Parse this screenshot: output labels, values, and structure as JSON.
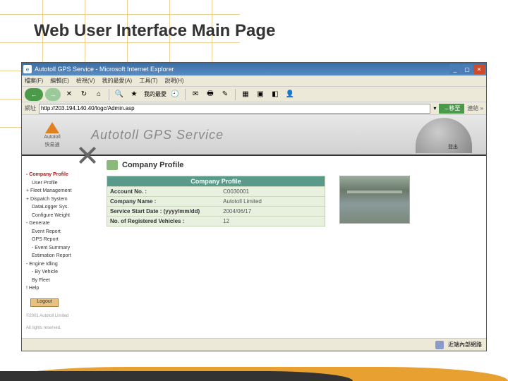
{
  "slide": {
    "title": "Web User Interface Main Page"
  },
  "browser": {
    "title": "Autotoll GPS Service - Microsoft Internet Explorer",
    "menus": [
      "檔案(F)",
      "編輯(E)",
      "檢視(V)",
      "我的最愛(A)",
      "工具(T)",
      "說明(H)"
    ],
    "favorites_label": "我的最愛",
    "address_label": "網址",
    "address_value": "http://203.194.140.40/logc/Admin.asp",
    "go_label": "移至",
    "links_label": "連結 »",
    "status_text": "近端內部網路"
  },
  "app": {
    "logo_text": "Autotoll",
    "logo_sub": "快易通",
    "banner_title": "Autotoll GPS Service",
    "logout_link": "登出"
  },
  "sidebar": {
    "items": [
      {
        "label": "- Company Profile",
        "red": true,
        "indent": false
      },
      {
        "label": "User Profile",
        "red": false,
        "indent": true
      },
      {
        "label": "+ Fleet Management",
        "red": false,
        "indent": false
      },
      {
        "label": "+ Dispatch System",
        "red": false,
        "indent": false
      },
      {
        "label": "DataLogger Sys.",
        "red": false,
        "indent": true
      },
      {
        "label": "Configure Weight",
        "red": false,
        "indent": true
      },
      {
        "label": "- Generate",
        "red": false,
        "indent": false
      },
      {
        "label": "Event Report",
        "red": false,
        "indent": true
      },
      {
        "label": "GPS Report",
        "red": false,
        "indent": true
      },
      {
        "label": "- Event Summary",
        "red": false,
        "indent": true
      },
      {
        "label": "Estimation Report",
        "red": false,
        "indent": true
      },
      {
        "label": "- Engine Idling",
        "red": false,
        "indent": false
      },
      {
        "label": "- By Vehicle",
        "red": false,
        "indent": true
      },
      {
        "label": "By Fleet",
        "red": false,
        "indent": true
      },
      {
        "label": "! Help",
        "red": false,
        "indent": false
      }
    ],
    "logout_btn": "Logout",
    "footer1": "©2001 Autotoll Limited",
    "footer2": "All rights reserved."
  },
  "profile": {
    "section_title": "Company Profile",
    "panel_title": "Company Profile",
    "rows": [
      {
        "label": "Account No. :",
        "value": "C0030001"
      },
      {
        "label": "Company Name :",
        "value": "Autotoll Limited"
      },
      {
        "label": "Service Start Date :\n(yyyy/mm/dd)",
        "value": "2004/06/17"
      },
      {
        "label": "No. of Registered Vehicles :",
        "value": "12"
      }
    ]
  }
}
